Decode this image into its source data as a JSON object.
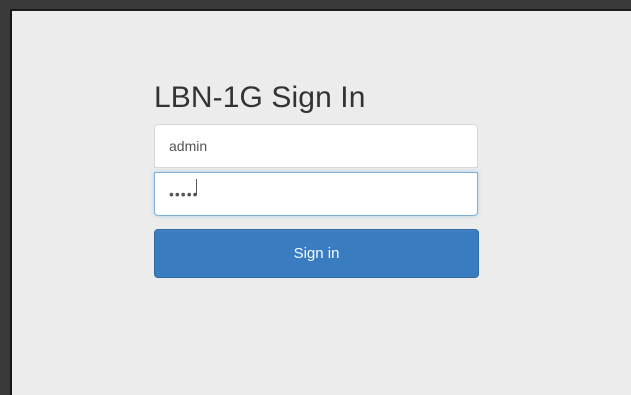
{
  "page": {
    "title": "LBN-1G Sign In"
  },
  "form": {
    "username_value": "admin",
    "password_value": "•••••",
    "submit_label": "Sign in"
  },
  "colors": {
    "background": "#ececec",
    "button": "#3a7cc0",
    "text": "#333333"
  }
}
